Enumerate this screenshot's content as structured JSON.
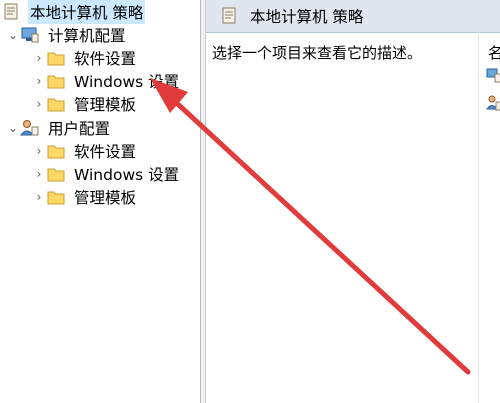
{
  "tree": {
    "root": "本地计算机 策略",
    "computer_config": "计算机配置",
    "computer_children": [
      "软件设置",
      "Windows 设置",
      "管理模板"
    ],
    "user_config": "用户配置",
    "user_children": [
      "软件设置",
      "Windows 设置",
      "管理模板"
    ]
  },
  "right": {
    "header_title": "本地计算机 策略",
    "description": "选择一个项目来查看它的描述。",
    "column_header": "名"
  },
  "colors": {
    "header_bg": "#dfe6f0",
    "selection_bg": "#cce8ff",
    "arrow": "#e23b3b",
    "folder_fill": "#ffd764"
  }
}
